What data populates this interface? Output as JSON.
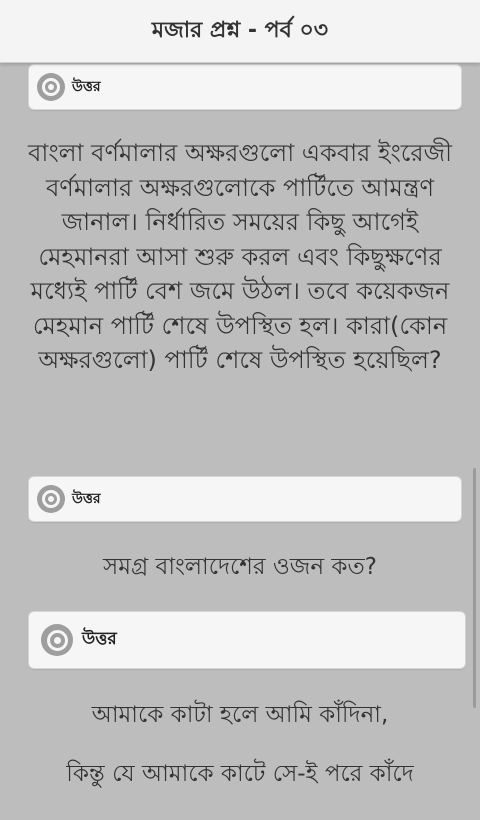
{
  "header": {
    "title": "মজার প্রশ্ন - পর্ব ০৩"
  },
  "answer_label": "উত্তর",
  "questions": [
    {
      "text": "বাংলা বর্ণমালার অক্ষরগুলো একবার ইংরেজী বর্ণমালার অক্ষরগুলোকে পার্টিতে আমন্ত্রণ জানাল। নির্ধারিত সময়ের কিছু আগেই মেহমানরা আসা শুরু করল এবং কিছুক্ষণের মধ্যেই পার্টি বেশ জমে উঠল। তবে কয়েকজন মেহমান পার্টি শেষে উপস্থিত হল। কারা(কোন অক্ষরগুলো) পার্টি শেষে উপস্থিত হয়েছিল?"
    },
    {
      "text": "সমগ্র বাংলাদেশের ওজন কত?"
    },
    {
      "line1": "আমাকে কাটা হলে আমি কাঁদিনা,",
      "line2": "কিন্তু যে আমাকে কাটে সে-ই পরে কাঁদে"
    }
  ]
}
